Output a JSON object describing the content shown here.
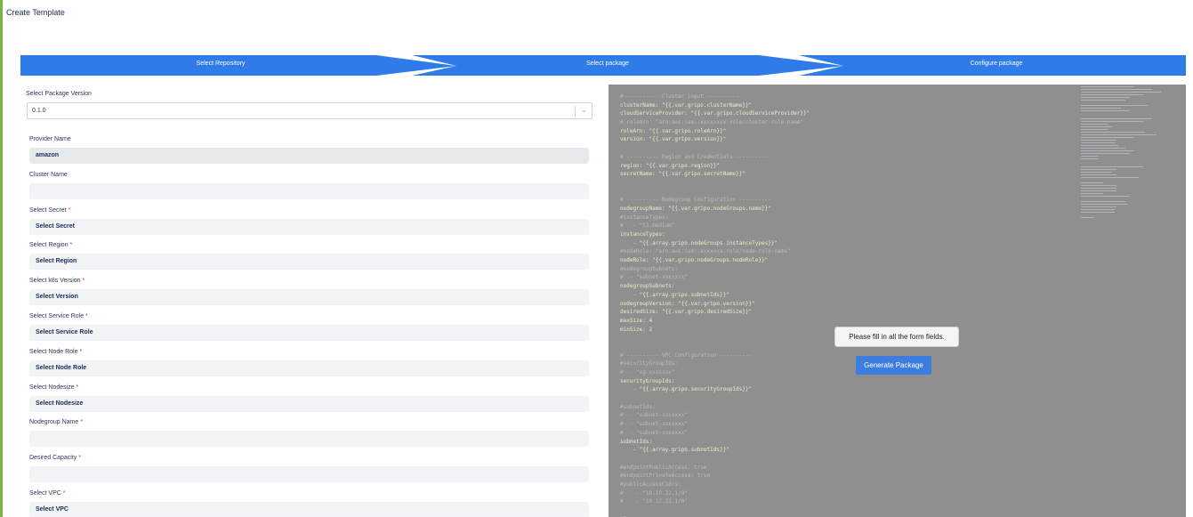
{
  "page": {
    "title": "Create Template"
  },
  "stepper": {
    "steps": [
      {
        "label": "Select Repository"
      },
      {
        "label": "Select package"
      },
      {
        "label": "Configure package"
      }
    ]
  },
  "form": {
    "package_version": {
      "label": "Select Package Version",
      "value": "0.1.0"
    },
    "fields": [
      {
        "label": "Provider Name",
        "value": "amazon",
        "required": ""
      },
      {
        "label": "Cluster Name",
        "value": "",
        "required": ""
      },
      {
        "label": "Select Secret",
        "value": "Select Secret",
        "required": "*"
      },
      {
        "label": "Select Region",
        "value": "Select Region",
        "required": "*"
      },
      {
        "label": "Select k8s Version",
        "value": "Select Version",
        "required": "*"
      },
      {
        "label": "Select Service Role",
        "value": "Select Service Role",
        "required": "*"
      },
      {
        "label": "Select Node Role",
        "value": "Select Node Role",
        "required": "*"
      },
      {
        "label": "Select Nodesize",
        "value": "Select Nodesize",
        "required": "*"
      },
      {
        "label": "Nodegroup Name",
        "value": "",
        "required": "*"
      },
      {
        "label": "Desired Capacity",
        "value": "",
        "required": "*"
      },
      {
        "label": "Select VPC",
        "value": "Select VPC",
        "required": "*"
      }
    ]
  },
  "code_preview": {
    "lines": [
      {
        "t": "# ---------- Cluster input ----------",
        "c": "comment"
      },
      {
        "t": "clusterName: \"{{.var.gripo.clusterName}}\"",
        "c": "key"
      },
      {
        "t": "cloudServiceProvider: \"{{.var.gripo.cloudServiceProvider}}\"",
        "c": "key"
      },
      {
        "t": "# roleArn: \"arn:aws:iam::xxxxxxxx:role/cluster-role-name\"",
        "c": "comment"
      },
      {
        "t": "roleArn: \"{{.var.gripo.roleArn}}\"",
        "c": "key"
      },
      {
        "t": "version: \"{{.var.gripo.version}}\"",
        "c": "key"
      },
      {
        "t": "",
        "c": "key"
      },
      {
        "t": "# ---------- Region and Credentials ----------",
        "c": "comment"
      },
      {
        "t": "region: \"{{.var.gripo.region}}\"",
        "c": "key"
      },
      {
        "t": "secretName: \"{{.var.gripo.secretName}}\"",
        "c": "key"
      },
      {
        "t": "",
        "c": "key"
      },
      {
        "t": "",
        "c": "key"
      },
      {
        "t": "# ---------- Nodegroup Configuration ----------",
        "c": "comment"
      },
      {
        "t": "nodegroupName: \"{{.var.gripo.nodeGroups.name}}\"",
        "c": "key"
      },
      {
        "t": "#instanceTypes:",
        "c": "comment"
      },
      {
        "t": "#   - \"t3.medium\"",
        "c": "comment"
      },
      {
        "t": "instanceTypes:",
        "c": "key"
      },
      {
        "t": "    - \"{{.array.gripo.nodeGroups.instanceTypes}}\"",
        "c": "key"
      },
      {
        "t": "#nodeRole: \"arn:aws:iam::xxxxxxx:role/node-role-name\"",
        "c": "comment"
      },
      {
        "t": "nodeRole: \"{{.var.gripo.nodeGroups.nodeRole}}\"",
        "c": "key"
      },
      {
        "t": "#nodegroupSubnets:",
        "c": "comment"
      },
      {
        "t": "#  - \"subnet-xxxxxxx\"",
        "c": "comment"
      },
      {
        "t": "nodegroupSubnets:",
        "c": "key"
      },
      {
        "t": "    - \"{{.array.gripo.subnetIds}}\"",
        "c": "key"
      },
      {
        "t": "nodegroupVersion: \"{{.var.gripo.version}}\"",
        "c": "key"
      },
      {
        "t": "desiredSize: \"{{.var.gripo.desiredSize}}\"",
        "c": "key"
      },
      {
        "t": "maxSize: 4",
        "c": "key"
      },
      {
        "t": "minSize: 2",
        "c": "key"
      },
      {
        "t": "",
        "c": "key"
      },
      {
        "t": "",
        "c": "key"
      },
      {
        "t": "# ---------- VPC Configuration ----------",
        "c": "comment"
      },
      {
        "t": "#securityGroupIds:",
        "c": "comment"
      },
      {
        "t": "#  - \"sg-xxxxxxx\"",
        "c": "comment"
      },
      {
        "t": "securityGroupIds:",
        "c": "key"
      },
      {
        "t": "    - \"{{.array.gripo.securityGroupIds}}\"",
        "c": "key"
      },
      {
        "t": "",
        "c": "key"
      },
      {
        "t": "#subnetIds:",
        "c": "comment"
      },
      {
        "t": "#  - \"subnet-xxxxxxx\"",
        "c": "comment"
      },
      {
        "t": "#  - \"subnet-xxxxxxx\"",
        "c": "comment"
      },
      {
        "t": "#  - \"subnet-xxxxxxx\"",
        "c": "comment"
      },
      {
        "t": "subnetIds:",
        "c": "key"
      },
      {
        "t": "    - \"{{.array.gripo.subnetIds}}\"",
        "c": "key"
      },
      {
        "t": "",
        "c": "key"
      },
      {
        "t": "#endpointPublicAccess: true",
        "c": "comment"
      },
      {
        "t": "#endpointPrivateAccess: true",
        "c": "comment"
      },
      {
        "t": "#publicAccessCidrs:",
        "c": "comment"
      },
      {
        "t": "#    - \"10.10.22.1/0\"",
        "c": "comment"
      },
      {
        "t": "#    - \"10.12.22.1/0\"",
        "c": "comment"
      },
      {
        "t": "",
        "c": "key"
      },
      {
        "t": "#Tags:",
        "c": "comment"
      }
    ],
    "tooltip": "Please fill in all the form fields.",
    "generate_label": "Generate Package"
  },
  "colors": {
    "accent": "#2f7bea",
    "panel": "#8f8f8f",
    "button": "#3d7de0",
    "required": "#d32f2f"
  }
}
